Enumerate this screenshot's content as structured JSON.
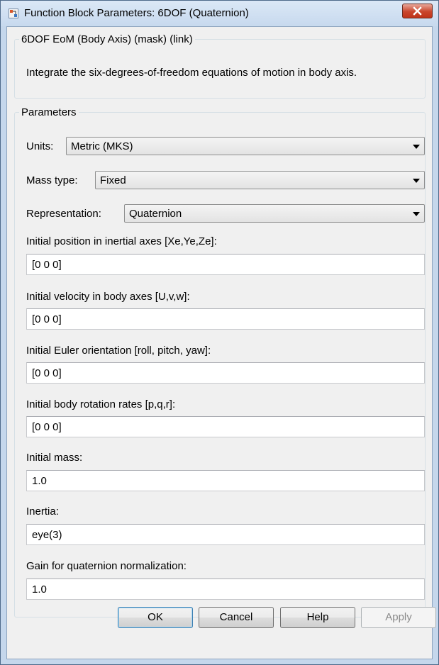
{
  "window": {
    "title": "Function Block Parameters: 6DOF (Quaternion)"
  },
  "description": {
    "group_label": "6DOF EoM (Body Axis) (mask) (link)",
    "text": "Integrate the six-degrees-of-freedom equations of motion in body axis."
  },
  "parameters": {
    "group_label": "Parameters",
    "units": {
      "label": "Units:",
      "value": "Metric (MKS)"
    },
    "mass_type": {
      "label": "Mass type:",
      "value": "Fixed"
    },
    "representation": {
      "label": "Representation:",
      "value": "Quaternion"
    },
    "initial_position": {
      "label": "Initial position in inertial axes [Xe,Ye,Ze]:",
      "value": "[0 0 0]"
    },
    "initial_velocity": {
      "label": "Initial velocity in body axes [U,v,w]:",
      "value": "[0 0 0]"
    },
    "initial_euler": {
      "label": "Initial Euler orientation [roll, pitch, yaw]:",
      "value": "[0 0 0]"
    },
    "initial_rates": {
      "label": "Initial body rotation rates [p,q,r]:",
      "value": "[0 0 0]"
    },
    "initial_mass": {
      "label": "Initial mass:",
      "value": "1.0"
    },
    "inertia": {
      "label": "Inertia:",
      "value": "eye(3)"
    },
    "quaternion_gain": {
      "label": "Gain for quaternion normalization:",
      "value": "1.0"
    }
  },
  "buttons": {
    "ok": "OK",
    "cancel": "Cancel",
    "help": "Help",
    "apply": "Apply"
  },
  "colors": {
    "window_frame": "#c5d7ec",
    "client_bg": "#f0f0f0",
    "close_button": "#c9452b",
    "default_button_border": "#3c7fb1"
  },
  "icons": {
    "app": "simulink-block-icon",
    "close": "close-x-icon"
  }
}
